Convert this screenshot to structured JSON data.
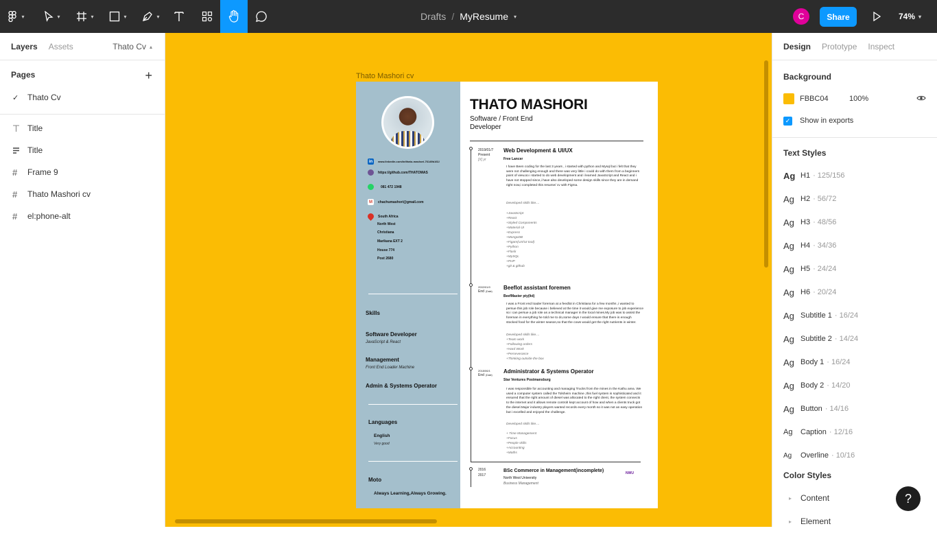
{
  "toolbar": {
    "tools": [
      "figma-menu-icon",
      "move-tool-icon",
      "frame-tool-icon",
      "shape-tool-icon",
      "pen-tool-icon",
      "text-tool-icon",
      "resources-icon",
      "hand-tool-icon",
      "comment-tool-icon"
    ],
    "breadcrumb_folder": "Drafts",
    "breadcrumb_sep": "/",
    "file_name": "MyResume",
    "avatar_letter": "C",
    "share_label": "Share",
    "zoom": "74%",
    "accent": "#0d99ff"
  },
  "left_panel": {
    "tabs": [
      "Layers",
      "Assets"
    ],
    "page_selector": "Thato Cv",
    "pages_header": "Pages",
    "pages": [
      "Thato Cv"
    ],
    "layers": [
      {
        "icon": "text-icon",
        "label": "Title"
      },
      {
        "icon": "autolayout-icon",
        "label": "Title"
      },
      {
        "icon": "frame-icon",
        "label": "Frame 9"
      },
      {
        "icon": "frame-icon",
        "label": "Thato Mashori cv"
      },
      {
        "icon": "frame-icon",
        "label": "el:phone-alt"
      }
    ]
  },
  "canvas": {
    "background": "#fbbc04",
    "frame_label": "Thato Mashori cv",
    "resume": {
      "name": "THATO MASHORI",
      "role": "Software / Front End Developer",
      "contacts": [
        {
          "icon": "linkedin-icon",
          "text": "www.linkedin.com/in/thato-mashori-76149b161/"
        },
        {
          "icon": "github-icon",
          "text": "https://github.com/THATOMAS"
        },
        {
          "icon": "whatsapp-icon",
          "text": "081 472 1948"
        },
        {
          "icon": "gmail-icon",
          "text": "chachumashori@gmail.com"
        },
        {
          "icon": "location-icon",
          "text": "South Africa"
        }
      ],
      "address_lines": [
        "North West",
        "Christiana",
        "Marikana EXT 2",
        "House 774",
        "Post 2680"
      ],
      "skills_header": "Skills",
      "skills": [
        {
          "title": "Software Developer",
          "sub": "JavaScript & React"
        },
        {
          "title": "Management",
          "sub": "Front End Loader Machine"
        },
        {
          "title": "Admin & Systems Operator",
          "sub": ""
        }
      ],
      "languages_header": "Languages",
      "language": "English",
      "language_level": "Very good",
      "moto_header": "Moto",
      "moto": "Always Learning,Always Growing.",
      "jobs": [
        {
          "date1": "2019/01/7",
          "date2": "Present",
          "date3": "[X] yr",
          "title": "Web Development & UI/UX",
          "company": "Free Lancer",
          "desc": "I have Been coding for the last 3 years , i started with python and Mysql but i felt that they were not challenging enough and there was very little i could do with them from a beginners point of view,so i started to do web development and i learned JavaScript and React and i have not stopped since,i have also developed some design skills since they are in demand right now,i completed this resume/ cv with Figma.",
          "list_title": "Developed skills like....",
          "list": "+JavaScript\n+React\n+Styled Components\n+Material UI\n+Express\n+MongoDB\n+Figam(UX/UI tool)\n+Python\n+Flask\n+MySQL\n+PHP\n+git & github"
        },
        {
          "date1": "2002/01/0",
          "date2": "End",
          "date3": "(Date)",
          "title": "Beeflot assistant foremen",
          "company": "BeefMaster pty(ltd)",
          "desc": "I was a Front end loader foreman at a feedlot in Christiana for a few months ,i wanted to persue this job role because i believed at the time it would give me exposure to job experience so i can persue a job role as a technical manager in the local mines.My job was to assist the foreman in everything he told me to do,some days I would ensure that there is enough stocked food for the winter season,so that the cows would get the right nutrients in winter.",
          "list_title": "Developed skills like....",
          "list": "+Team work\n+Following orders\n+Hard Work\n+Perseverance\n+Thinking outside the box"
        },
        {
          "date1": "2018/06/1",
          "date2": "End",
          "date3": "(Date)",
          "title": "Administrator & Systems Operator",
          "company": "Star Ventures Postmansburg",
          "desc": "I was responsible for accounting and managing Trucks from the mines in the Kathu area. We used a computer system called the Tolsheim machine ,this fuel system is sophisticated and it ensured that the right amount of diesel was allocated to the right client, the system connects to the internet and it allows remote controlI kept account of how and when a clients truck got the diesel.Major industry players wanted records every month so it was not an easy operation but i excelled and enjoyed the challenge.",
          "list_title": "Developed skills like....",
          "list": "+ Time Management\n+Focus\n+People skills\n+Accounting\n+Maths"
        }
      ],
      "education": {
        "date1": "2016",
        "date2": "2017",
        "title": "BSc Commerce in Management(incomplete)",
        "school": "North West University",
        "field": "Business Management",
        "logo_text": "NWU"
      }
    }
  },
  "right_panel": {
    "tabs": [
      "Design",
      "Prototype",
      "Inspect"
    ],
    "background_header": "Background",
    "bg_hex": "FBBC04",
    "bg_opacity": "100%",
    "show_exports": "Show in exports",
    "text_styles_header": "Text Styles",
    "text_styles": [
      {
        "ag": "Ag",
        "name": "H1",
        "meta": "· 125/156"
      },
      {
        "ag": "Ag",
        "name": "H2",
        "meta": "· 56/72"
      },
      {
        "ag": "Ag",
        "name": "H3",
        "meta": "· 48/56"
      },
      {
        "ag": "Ag",
        "name": "H4",
        "meta": "· 34/36"
      },
      {
        "ag": "Ag",
        "name": "H5",
        "meta": "· 24/24"
      },
      {
        "ag": "Ag",
        "name": "H6",
        "meta": "· 20/24"
      },
      {
        "ag": "Ag",
        "name": "Subtitle 1",
        "meta": "· 16/24"
      },
      {
        "ag": "Ag",
        "name": "Subtitle 2",
        "meta": "· 14/24"
      },
      {
        "ag": "Ag",
        "name": "Body 1",
        "meta": "· 16/24"
      },
      {
        "ag": "Ag",
        "name": "Body 2",
        "meta": "· 14/20"
      },
      {
        "ag": "Ag",
        "name": "Button",
        "meta": "· 14/16"
      },
      {
        "ag": "Ag",
        "name": "Caption",
        "meta": "· 12/16"
      },
      {
        "ag": "Ag",
        "name": "Overline",
        "meta": "· 10/16"
      }
    ],
    "color_styles_header": "Color Styles",
    "color_styles": [
      "Content",
      "Element"
    ]
  },
  "help_label": "?"
}
